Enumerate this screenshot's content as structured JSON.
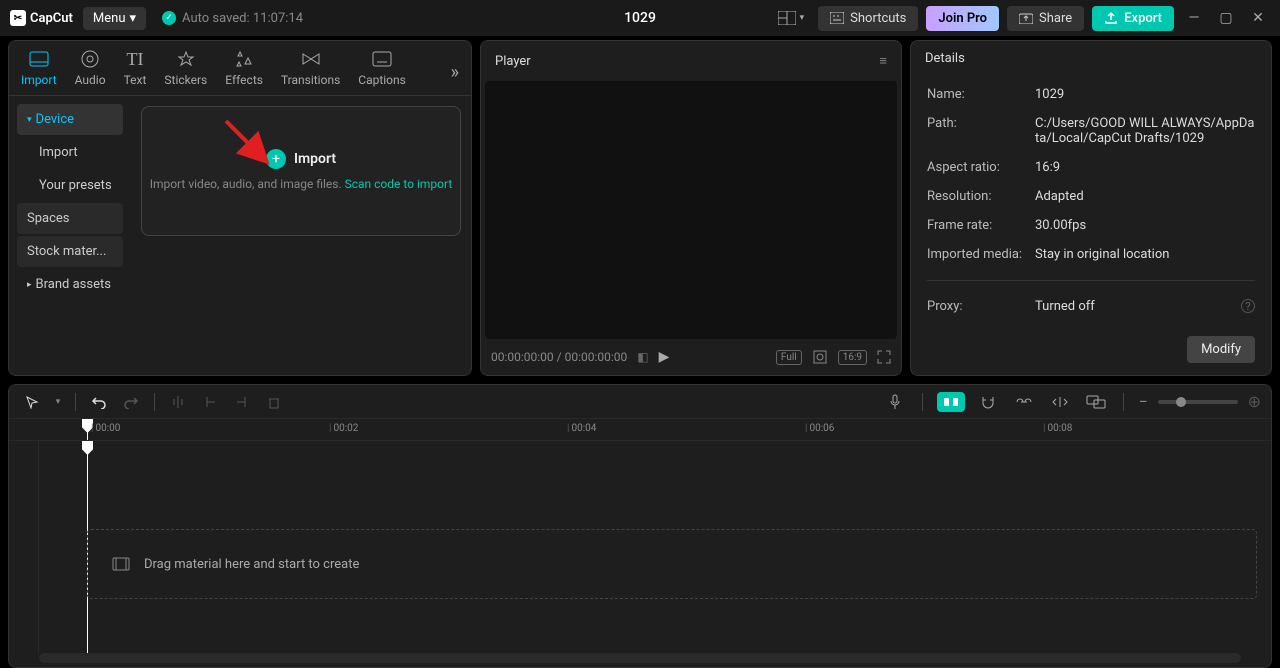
{
  "app": {
    "name": "CapCut"
  },
  "menu_label": "Menu",
  "autosave": "Auto saved: 11:07:14",
  "project_title": "1029",
  "topbar": {
    "shortcuts": "Shortcuts",
    "join_pro": "Join Pro",
    "share": "Share",
    "export": "Export"
  },
  "tabs": {
    "import": "Import",
    "audio": "Audio",
    "text": "Text",
    "stickers": "Stickers",
    "effects": "Effects",
    "transitions": "Transitions",
    "captions": "Captions"
  },
  "sidebar": {
    "device": "Device",
    "import": "Import",
    "presets": "Your presets",
    "spaces": "Spaces",
    "stock": "Stock mater...",
    "brand": "Brand assets"
  },
  "import_box": {
    "title": "Import",
    "hint_pre": "Import video, audio, and image files. ",
    "link": "Scan code to import"
  },
  "player": {
    "title": "Player",
    "time_current": "00:00:00:00",
    "time_sep": " / ",
    "time_total": "00:00:00:00",
    "full": "Full",
    "ratio": "16:9"
  },
  "details": {
    "title": "Details",
    "name_label": "Name:",
    "name_val": "1029",
    "path_label": "Path:",
    "path_val": "C:/Users/GOOD WILL ALWAYS/AppData/Local/CapCut Drafts/1029",
    "aspect_label": "Aspect ratio:",
    "aspect_val": "16:9",
    "res_label": "Resolution:",
    "res_val": "Adapted",
    "fps_label": "Frame rate:",
    "fps_val": "30.00fps",
    "media_label": "Imported media:",
    "media_val": "Stay in original location",
    "proxy_label": "Proxy:",
    "proxy_val": "Turned off",
    "modify": "Modify"
  },
  "ruler": {
    "m0": "00:00",
    "m2": "00:02",
    "m4": "00:04",
    "m6": "00:06",
    "m8": "00:08"
  },
  "timeline": {
    "drop_hint": "Drag material here and start to create"
  }
}
